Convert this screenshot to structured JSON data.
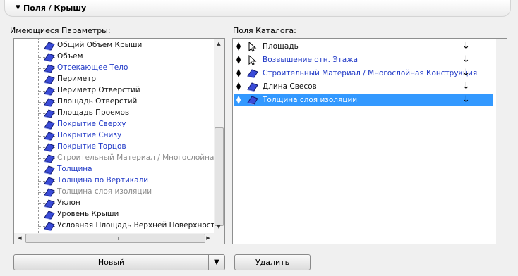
{
  "header": {
    "title": "Поля / Крышу"
  },
  "left_panel": {
    "label": "Имеющиеся Параметры:",
    "items": [
      {
        "label": "Общий Объем Крыши",
        "color": "black"
      },
      {
        "label": "Объем",
        "color": "black"
      },
      {
        "label": "Отсекающее Тело",
        "color": "blue"
      },
      {
        "label": "Периметр",
        "color": "black"
      },
      {
        "label": "Периметр Отверстий",
        "color": "black"
      },
      {
        "label": "Площадь Отверстий",
        "color": "black"
      },
      {
        "label": "Площадь Проемов",
        "color": "black"
      },
      {
        "label": "Покрытие Сверху",
        "color": "blue"
      },
      {
        "label": "Покрытие Снизу",
        "color": "blue"
      },
      {
        "label": "Покрытие Торцов",
        "color": "blue"
      },
      {
        "label": "Строительный Материал / Многослойная Кон",
        "color": "gray"
      },
      {
        "label": "Толщина",
        "color": "blue"
      },
      {
        "label": "Толщина по Вертикали",
        "color": "blue"
      },
      {
        "label": "Толщина слоя изоляции",
        "color": "gray"
      },
      {
        "label": "Уклон",
        "color": "black"
      },
      {
        "label": "Уровень Крыши",
        "color": "black"
      },
      {
        "label": "Условная Площадь Верхней Поверхности",
        "color": "black"
      }
    ]
  },
  "right_panel": {
    "label": "Поля Каталога:",
    "items": [
      {
        "label": "Площадь",
        "color": "black",
        "icon": "cursor-icon",
        "selected": false
      },
      {
        "label": "Возвышение отн. Этажа",
        "color": "blue",
        "icon": "cursor-icon",
        "selected": false
      },
      {
        "label": "Строительный Материал / Многослойная Конструкция",
        "color": "blue",
        "icon": "roof-icon",
        "selected": false
      },
      {
        "label": "Длина Свесов",
        "color": "black",
        "icon": "roof-icon",
        "selected": false
      },
      {
        "label": "Толщина слоя изоляции",
        "color": "white",
        "icon": "roof-icon",
        "selected": true
      }
    ]
  },
  "buttons": {
    "new_label": "Новый",
    "delete_label": "Удалить"
  },
  "colors": {
    "selection": "#3399ff",
    "blue_text": "#1f38c6",
    "gray_text": "#8a8a8a"
  }
}
